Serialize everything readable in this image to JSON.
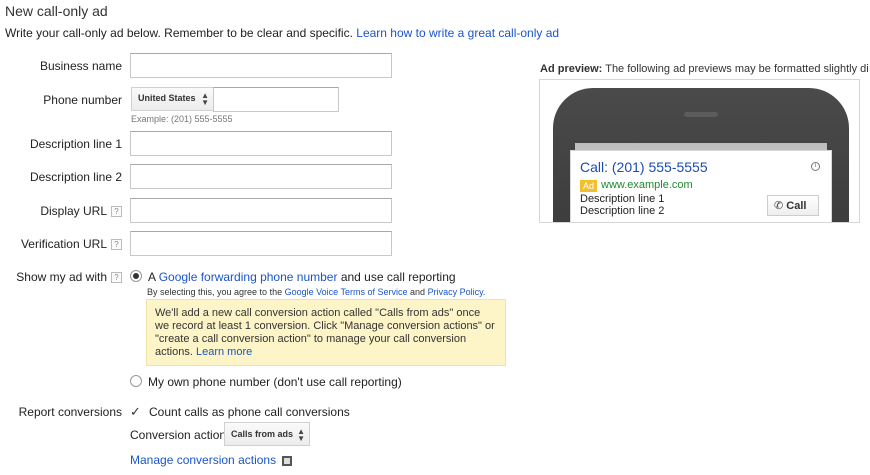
{
  "page": {
    "title": "New call-only ad",
    "subtitle": "Write your call-only ad below. Remember to be clear and specific.",
    "subtitle_link": "Learn how to write a great call-only ad"
  },
  "form": {
    "business_name_label": "Business name",
    "phone_number_label": "Phone number",
    "country_value": "United States",
    "phone_example": "Example: (201) 555-5555",
    "description1_label": "Description line 1",
    "description2_label": "Description line 2",
    "display_url_label": "Display URL",
    "verification_url_label": "Verification URL",
    "help_glyph": "?",
    "show_ad_label": "Show my ad with",
    "option1_prefix": "A",
    "option1_link": "Google forwarding phone number",
    "option1_suffix": "and use call reporting",
    "agree_prefix": "By selecting this, you agree to the",
    "agree_link1": "Google Voice Terms of Service",
    "agree_and": "and",
    "agree_link2": "Privacy Policy.",
    "note_text": "We'll add a new call conversion action called \"Calls from ads\" once we record at least 1 conversion. Click \"Manage conversion actions\" or \"create a call conversion action\" to manage your call conversion actions.",
    "note_link": "Learn more",
    "option2_label": "My own phone number (don't use call reporting)",
    "report_label": "Report conversions",
    "count_calls_label": "Count calls as phone call conversions",
    "conversion_action_label": "Conversion action",
    "conversion_action_value": "Calls from ads",
    "manage_link": "Manage conversion actions"
  },
  "preview": {
    "title_bold": "Ad preview:",
    "title_rest": "The following ad previews may be formatted slightly di",
    "headline": "Call: (201) 555-5555",
    "badge": "Ad",
    "url": "www.example.com",
    "desc1": "Description line 1",
    "desc2": "Description line 2",
    "call_button": "Call",
    "info_glyph": "i"
  },
  "state": {
    "selected_option": "google_forwarding",
    "count_calls_checked": true
  },
  "icons": [
    "help-icon",
    "radio-icon",
    "checkbox-icon",
    "phone-icon",
    "info-icon",
    "external-link-icon",
    "select-arrows-icon"
  ],
  "colors": {
    "link": "#1a55c9",
    "note_background": "#fdf4c7",
    "ad_badge": "#f2c02b",
    "ad_url": "#1e8b2f",
    "ad_headline": "#1a4db0"
  }
}
